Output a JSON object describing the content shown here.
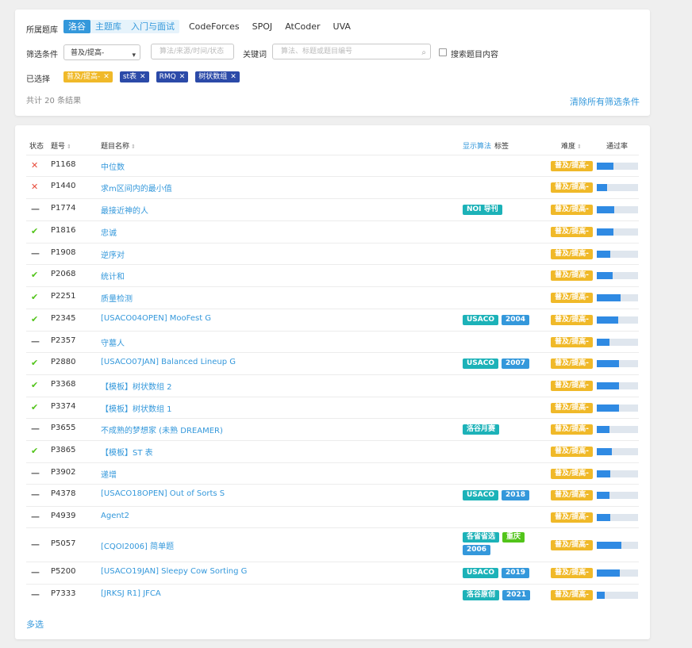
{
  "filter": {
    "source_label": "所属题库",
    "tabs": [
      "洛谷",
      "主题库",
      "入门与面试",
      "CodeForces",
      "SPOJ",
      "AtCoder",
      "UVA"
    ],
    "condition_label": "筛选条件",
    "difficulty_value": "普及/提高-",
    "source_placeholder": "算法/来源/时间/状态",
    "keyword_label": "关键词",
    "keyword_placeholder": "算法、标题或题目编号",
    "search_content_label": "搜索题目内容",
    "selected_label": "已选择",
    "chips": [
      {
        "label": "普及/提高-",
        "color": "#f0b929"
      },
      {
        "label": "st表",
        "color": "#2b4aa8"
      },
      {
        "label": "RMQ",
        "color": "#2b4aa8"
      },
      {
        "label": "树状数组",
        "color": "#2b4aa8"
      }
    ],
    "total": "共计 20 条结果",
    "clear": "清除所有筛选条件"
  },
  "table": {
    "headers": {
      "status": "状态",
      "pid": "题号",
      "title": "题目名称",
      "show_algo": "显示算法",
      "tags": "标签",
      "difficulty": "难度",
      "pass_rate": "通过率"
    },
    "rows": [
      {
        "status": "wrong",
        "pid": "P1168",
        "title": "中位数",
        "tags": [],
        "diff": "普及/提高-",
        "pass": 0.4
      },
      {
        "status": "wrong",
        "pid": "P1440",
        "title": "求m区间内的最小值",
        "tags": [],
        "diff": "普及/提高-",
        "pass": 0.25
      },
      {
        "status": "none",
        "pid": "P1774",
        "title": "最接近神的人",
        "tags": [
          {
            "t": "NOI 导刊",
            "c": "#1cb2b8"
          }
        ],
        "diff": "普及/提高-",
        "pass": 0.42
      },
      {
        "status": "ac",
        "pid": "P1816",
        "title": "忠诚",
        "tags": [],
        "diff": "普及/提高-",
        "pass": 0.4
      },
      {
        "status": "none",
        "pid": "P1908",
        "title": "逆序对",
        "tags": [],
        "diff": "普及/提高-",
        "pass": 0.32
      },
      {
        "status": "ac",
        "pid": "P2068",
        "title": "统计和",
        "tags": [],
        "diff": "普及/提高-",
        "pass": 0.38
      },
      {
        "status": "ac",
        "pid": "P2251",
        "title": "质量检测",
        "tags": [],
        "diff": "普及/提高-",
        "pass": 0.58
      },
      {
        "status": "ac",
        "pid": "P2345",
        "title": "[USACO04OPEN] MooFest G",
        "tags": [
          {
            "t": "USACO",
            "c": "#1cb2b8"
          },
          {
            "t": "2004",
            "c": "#3498db"
          }
        ],
        "diff": "普及/提高-",
        "pass": 0.52
      },
      {
        "status": "none",
        "pid": "P2357",
        "title": "守墓人",
        "tags": [],
        "diff": "普及/提高-",
        "pass": 0.3
      },
      {
        "status": "ac",
        "pid": "P2880",
        "title": "[USACO07JAN] Balanced Lineup G",
        "tags": [
          {
            "t": "USACO",
            "c": "#1cb2b8"
          },
          {
            "t": "2007",
            "c": "#3498db"
          }
        ],
        "diff": "普及/提高-",
        "pass": 0.53
      },
      {
        "status": "ac",
        "pid": "P3368",
        "title": "【模板】树状数组 2",
        "tags": [],
        "diff": "普及/提高-",
        "pass": 0.53
      },
      {
        "status": "ac",
        "pid": "P3374",
        "title": "【模板】树状数组 1",
        "tags": [],
        "diff": "普及/提高-",
        "pass": 0.53
      },
      {
        "status": "none",
        "pid": "P3655",
        "title": "不成熟的梦想家 (未熟 DREAMER)",
        "tags": [
          {
            "t": "洛谷月赛",
            "c": "#1cb2b8"
          }
        ],
        "diff": "普及/提高-",
        "pass": 0.3
      },
      {
        "status": "ac",
        "pid": "P3865",
        "title": "【模板】ST 表",
        "tags": [],
        "diff": "普及/提高-",
        "pass": 0.36
      },
      {
        "status": "none",
        "pid": "P3902",
        "title": "递增",
        "tags": [],
        "diff": "普及/提高-",
        "pass": 0.33
      },
      {
        "status": "none",
        "pid": "P4378",
        "title": "[USACO18OPEN] Out of Sorts S",
        "tags": [
          {
            "t": "USACO",
            "c": "#1cb2b8"
          },
          {
            "t": "2018",
            "c": "#3498db"
          }
        ],
        "diff": "普及/提高-",
        "pass": 0.3
      },
      {
        "status": "none",
        "pid": "P4939",
        "title": "Agent2",
        "tags": [],
        "diff": "普及/提高-",
        "pass": 0.33
      },
      {
        "status": "none",
        "pid": "P5057",
        "title": "[CQOI2006] 简单题",
        "tags": [
          {
            "t": "各省省选",
            "c": "#1cb2b8"
          },
          {
            "t": "重庆",
            "c": "#52c41a"
          },
          {
            "t": "2006",
            "c": "#3498db"
          }
        ],
        "diff": "普及/提高-",
        "pass": 0.6
      },
      {
        "status": "none",
        "pid": "P5200",
        "title": "[USACO19JAN] Sleepy Cow Sorting G",
        "tags": [
          {
            "t": "USACO",
            "c": "#1cb2b8"
          },
          {
            "t": "2019",
            "c": "#3498db"
          }
        ],
        "diff": "普及/提高-",
        "pass": 0.56
      },
      {
        "status": "none",
        "pid": "P7333",
        "title": "[JRKSJ R1] JFCA",
        "tags": [
          {
            "t": "洛谷原创",
            "c": "#1cb2b8"
          },
          {
            "t": "2021",
            "c": "#3498db"
          }
        ],
        "diff": "普及/提高-",
        "pass": 0.2
      }
    ]
  },
  "multi_select": "多选"
}
